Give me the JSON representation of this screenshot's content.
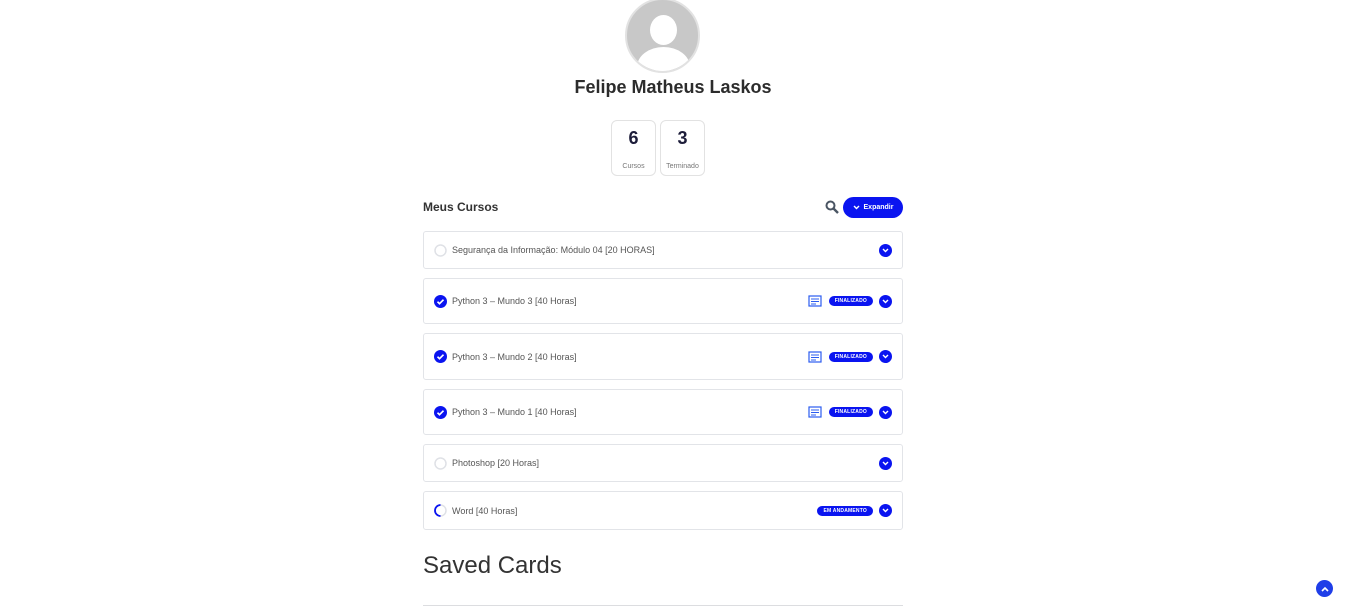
{
  "profile": {
    "name": "Felipe Matheus Laskos"
  },
  "stats": [
    {
      "value": "6",
      "label": "Cursos"
    },
    {
      "value": "3",
      "label": "Terminado"
    }
  ],
  "courses_section": {
    "title": "Meus Cursos",
    "expand_label": "Expandir"
  },
  "courses": [
    {
      "title": "Segurança da Informação: Módulo 04 [20 HORAS]",
      "status": "not-started",
      "badge": null
    },
    {
      "title": "Python 3 – Mundo 3 [40 Horas]",
      "status": "completed",
      "badge": "FINALIZADO",
      "certificate": true
    },
    {
      "title": "Python 3 – Mundo 2 [40 Horas]",
      "status": "completed",
      "badge": "FINALIZADO",
      "certificate": true
    },
    {
      "title": "Python 3 – Mundo 1 [40 Horas]",
      "status": "completed",
      "badge": "FINALIZADO",
      "certificate": true
    },
    {
      "title": "Photoshop [20 Horas]",
      "status": "not-started",
      "badge": null
    },
    {
      "title": "Word [40 Horas]",
      "status": "in-progress",
      "badge": "EM ANDAMENTO"
    }
  ],
  "saved_cards": {
    "title": "Saved Cards"
  },
  "colors": {
    "accent": "#0a14f0"
  }
}
